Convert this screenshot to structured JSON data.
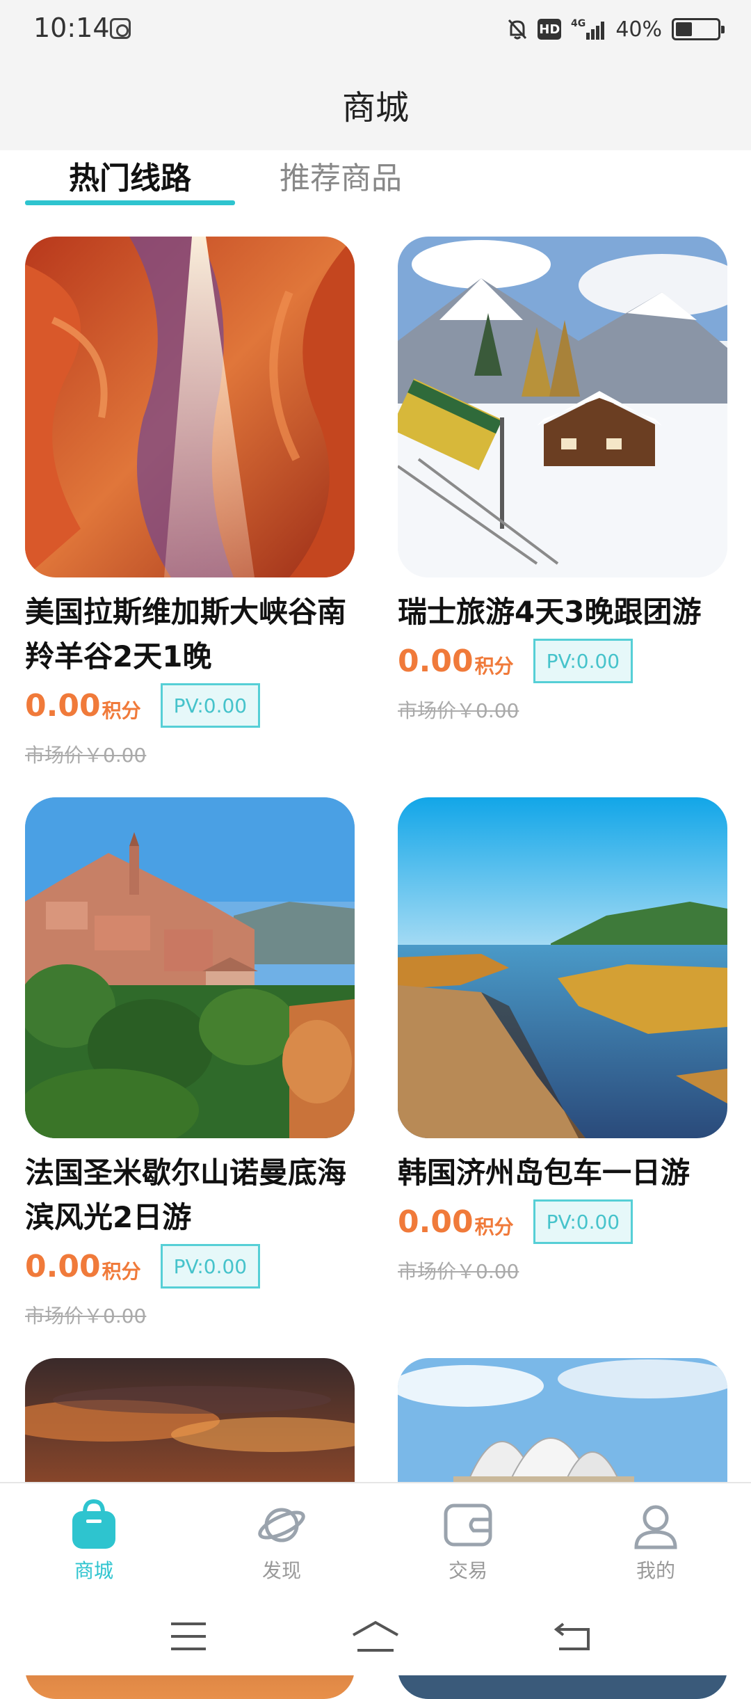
{
  "status": {
    "time": "10:14",
    "network": "4G",
    "battery": "40%",
    "hd": "HD",
    "battery_level": 0.4
  },
  "header": {
    "title": "商城"
  },
  "tabs": [
    {
      "label": "热门线路",
      "active": true
    },
    {
      "label": "推荐商品",
      "active": false
    }
  ],
  "products": [
    {
      "title": "美国拉斯维加斯大峡谷南羚羊谷2天1晚",
      "price": "0.00",
      "unit": "积分",
      "pv": "PV:0.00",
      "market": "市场价￥0.00",
      "image": "antelope-canyon-image"
    },
    {
      "title": "瑞士旅游4天3晚跟团游",
      "price": "0.00",
      "unit": "积分",
      "pv": "PV:0.00",
      "market": "市场价￥0.00",
      "image": "swiss-alps-train-image"
    },
    {
      "title": "法国圣米歇尔山诺曼底海滨风光2日游",
      "price": "0.00",
      "unit": "积分",
      "pv": "PV:0.00",
      "market": "市场价￥0.00",
      "image": "french-village-image"
    },
    {
      "title": "韩国济州岛包车一日游",
      "price": "0.00",
      "unit": "积分",
      "pv": "PV:0.00",
      "market": "市场价￥0.00",
      "image": "jeju-coast-image"
    },
    {
      "image": "sunset-clouds-image"
    },
    {
      "image": "sydney-opera-house-image"
    }
  ],
  "tabbar": [
    {
      "label": "商城",
      "icon": "shopping-bag-icon",
      "active": true
    },
    {
      "label": "发现",
      "icon": "planet-icon",
      "active": false
    },
    {
      "label": "交易",
      "icon": "wallet-icon",
      "active": false
    },
    {
      "label": "我的",
      "icon": "user-icon",
      "active": false
    }
  ],
  "colors": {
    "accent": "#2ec4cf",
    "price": "#f07a3a",
    "header_bg": "#f4f4f4"
  }
}
